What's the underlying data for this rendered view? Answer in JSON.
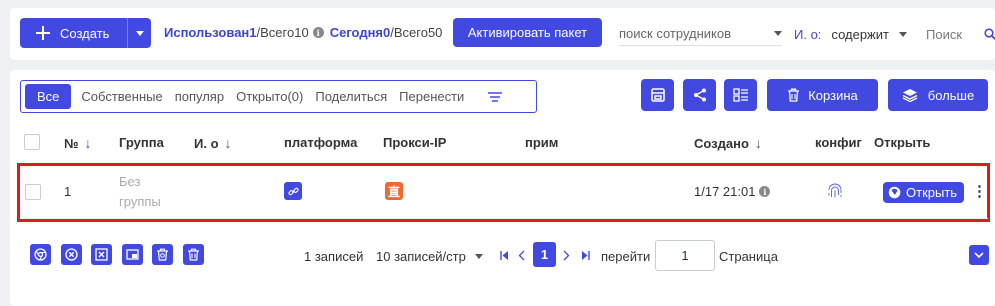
{
  "toolbar": {
    "create_label": "Создать",
    "used_label": "Использован",
    "used_count": "1",
    "total_label": "/Всего",
    "total_count": "10",
    "today_label": "Сегодня",
    "today_count": "0",
    "today_total_label": "/Всего",
    "today_total_count": "50",
    "activate_label": "Активировать пакет",
    "employee_search_placeholder": "поиск сотрудников",
    "filter_field_label": "И. о:",
    "filter_operator": "содержит",
    "search_placeholder": "Поиск"
  },
  "tabs": [
    {
      "label": "Все",
      "active": true
    },
    {
      "label": "Собственные"
    },
    {
      "label": "популяр"
    },
    {
      "label": "Открыто(0)"
    },
    {
      "label": "Поделиться"
    },
    {
      "label": "Перенести"
    }
  ],
  "actions": {
    "trash_label": "Корзина",
    "more_label": "больше"
  },
  "table": {
    "columns": {
      "num": "№",
      "group": "Группа",
      "name": "И. о",
      "platform": "платформа",
      "proxy": "Прокси-IP",
      "note": "прим",
      "created": "Создано",
      "config": "конфиг",
      "open": "Открыть"
    },
    "rows": [
      {
        "num": "1",
        "group_line1": "Без",
        "group_line2": "группы",
        "proxy_glyph": "直",
        "created": "1/17 21:01",
        "open_label": "Открыть"
      }
    ]
  },
  "pagination": {
    "records": "1 записей",
    "per_page": "10 записей/стр",
    "current_page": "1",
    "goto_label": "перейти",
    "goto_value": "1",
    "page_label": "Страница"
  },
  "colors": {
    "primary": "#4149e0",
    "proxy_badge": "#f06a2d",
    "highlight": "#dd1b21"
  }
}
